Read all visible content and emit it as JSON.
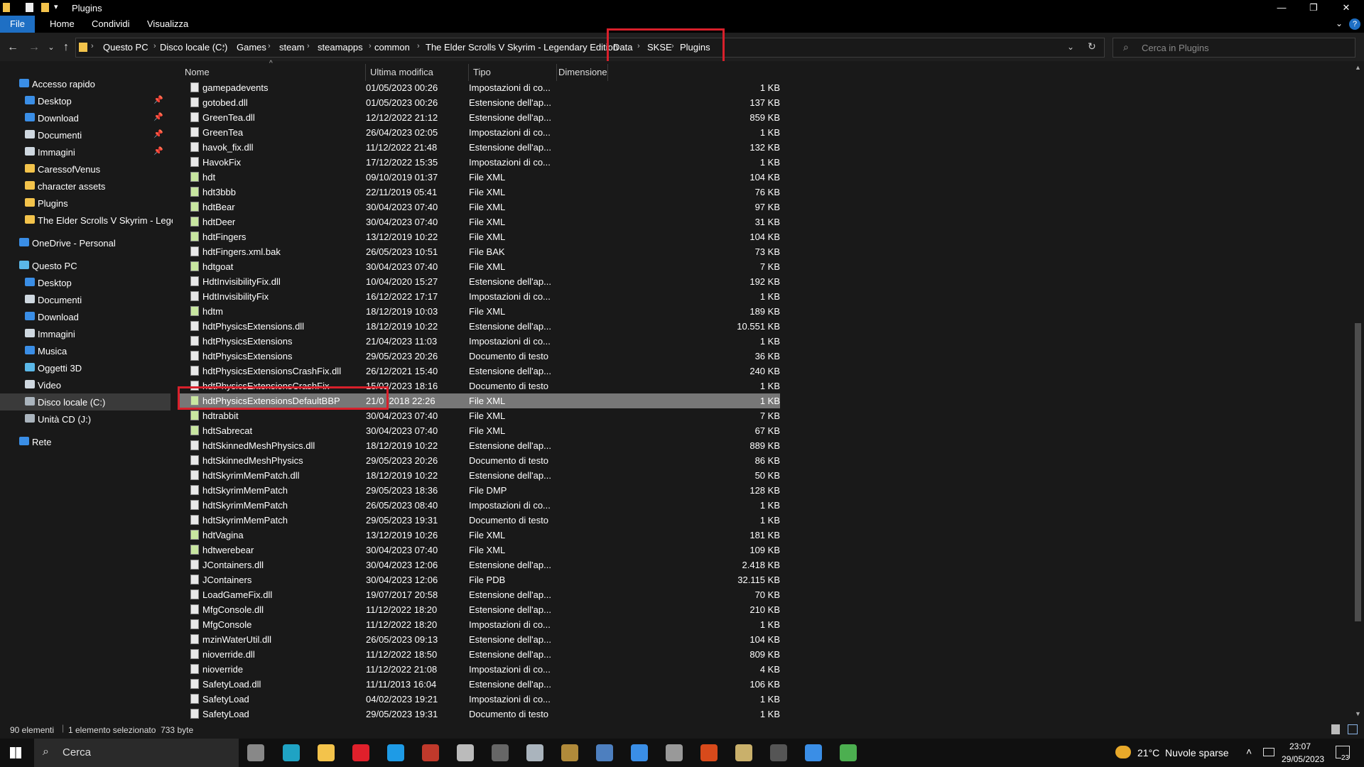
{
  "window": {
    "title": "Plugins",
    "min": "—",
    "max": "❐",
    "close": "✕"
  },
  "ribbon": {
    "tabs": [
      "File",
      "Home",
      "Condividi",
      "Visualizza"
    ]
  },
  "address": {
    "crumbs": [
      "Questo PC",
      "Disco locale (C:)",
      "Games",
      "steam",
      "steamapps",
      "common",
      "The Elder Scrolls V Skyrim - Legendary Edition",
      "Data",
      "SKSE",
      "Plugins"
    ],
    "search_placeholder": "Cerca in Plugins"
  },
  "nav": {
    "quick_access": "Accesso rapido",
    "quick_items": [
      {
        "label": "Desktop",
        "pinned": true,
        "icon": "desktop-icon",
        "color": "#3a8ee6"
      },
      {
        "label": "Download",
        "pinned": true,
        "icon": "download-icon",
        "color": "#3a8ee6"
      },
      {
        "label": "Documenti",
        "pinned": true,
        "icon": "documents-icon",
        "color": "#cfd8e0"
      },
      {
        "label": "Immagini",
        "pinned": true,
        "icon": "pictures-icon",
        "color": "#cfd8e0"
      },
      {
        "label": "CaressofVenus",
        "pinned": false,
        "icon": "folder-icon",
        "color": "#f3c34b"
      },
      {
        "label": "character assets",
        "pinned": false,
        "icon": "folder-icon",
        "color": "#f3c34b"
      },
      {
        "label": "Plugins",
        "pinned": false,
        "icon": "folder-icon",
        "color": "#f3c34b"
      },
      {
        "label": "The Elder Scrolls V Skyrim - Legendary",
        "pinned": false,
        "icon": "folder-icon",
        "color": "#f3c34b"
      }
    ],
    "onedrive": "OneDrive - Personal",
    "this_pc": "Questo PC",
    "pc_items": [
      {
        "label": "Desktop",
        "icon": "desktop-icon",
        "color": "#3a8ee6"
      },
      {
        "label": "Documenti",
        "icon": "documents-icon",
        "color": "#cfd8e0"
      },
      {
        "label": "Download",
        "icon": "download-icon",
        "color": "#3a8ee6"
      },
      {
        "label": "Immagini",
        "icon": "pictures-icon",
        "color": "#cfd8e0"
      },
      {
        "label": "Musica",
        "icon": "music-icon",
        "color": "#3a8ee6"
      },
      {
        "label": "Oggetti 3D",
        "icon": "3d-objects-icon",
        "color": "#5bb8e8"
      },
      {
        "label": "Video",
        "icon": "video-icon",
        "color": "#cfd8e0"
      },
      {
        "label": "Disco locale (C:)",
        "icon": "drive-icon",
        "color": "#aab4bd",
        "selected": true
      },
      {
        "label": "Unità CD (J:)",
        "icon": "cd-drive-icon",
        "color": "#aab4bd"
      }
    ],
    "network": "Rete"
  },
  "columns": {
    "name": "Nome",
    "modified": "Ultima modifica",
    "type": "Tipo",
    "size": "Dimensione"
  },
  "files": [
    {
      "name": "gamepadevents",
      "modified": "01/05/2023 00:26",
      "type": "Impostazioni di co...",
      "size": "1 KB",
      "kind": "ini"
    },
    {
      "name": "gotobed.dll",
      "modified": "01/05/2023 00:26",
      "type": "Estensione dell'ap...",
      "size": "137 KB",
      "kind": "dll"
    },
    {
      "name": "GreenTea.dll",
      "modified": "12/12/2022 21:12",
      "type": "Estensione dell'ap...",
      "size": "859 KB",
      "kind": "dll"
    },
    {
      "name": "GreenTea",
      "modified": "26/04/2023 02:05",
      "type": "Impostazioni di co...",
      "size": "1 KB",
      "kind": "ini"
    },
    {
      "name": "havok_fix.dll",
      "modified": "11/12/2022 21:48",
      "type": "Estensione dell'ap...",
      "size": "132 KB",
      "kind": "dll"
    },
    {
      "name": "HavokFix",
      "modified": "17/12/2022 15:35",
      "type": "Impostazioni di co...",
      "size": "1 KB",
      "kind": "ini"
    },
    {
      "name": "hdt",
      "modified": "09/10/2019 01:37",
      "type": "File XML",
      "size": "104 KB",
      "kind": "xml"
    },
    {
      "name": "hdt3bbb",
      "modified": "22/11/2019 05:41",
      "type": "File XML",
      "size": "76 KB",
      "kind": "xml"
    },
    {
      "name": "hdtBear",
      "modified": "30/04/2023 07:40",
      "type": "File XML",
      "size": "97 KB",
      "kind": "xml"
    },
    {
      "name": "hdtDeer",
      "modified": "30/04/2023 07:40",
      "type": "File XML",
      "size": "31 KB",
      "kind": "xml"
    },
    {
      "name": "hdtFingers",
      "modified": "13/12/2019 10:22",
      "type": "File XML",
      "size": "104 KB",
      "kind": "xml"
    },
    {
      "name": "hdtFingers.xml.bak",
      "modified": "26/05/2023 10:51",
      "type": "File BAK",
      "size": "73 KB",
      "kind": "bak"
    },
    {
      "name": "hdtgoat",
      "modified": "30/04/2023 07:40",
      "type": "File XML",
      "size": "7 KB",
      "kind": "xml"
    },
    {
      "name": "HdtInvisibilityFix.dll",
      "modified": "10/04/2020 15:27",
      "type": "Estensione dell'ap...",
      "size": "192 KB",
      "kind": "dll"
    },
    {
      "name": "HdtInvisibilityFix",
      "modified": "16/12/2022 17:17",
      "type": "Impostazioni di co...",
      "size": "1 KB",
      "kind": "ini"
    },
    {
      "name": "hdtm",
      "modified": "18/12/2019 10:03",
      "type": "File XML",
      "size": "189 KB",
      "kind": "xml"
    },
    {
      "name": "hdtPhysicsExtensions.dll",
      "modified": "18/12/2019 10:22",
      "type": "Estensione dell'ap...",
      "size": "10.551 KB",
      "kind": "dll"
    },
    {
      "name": "hdtPhysicsExtensions",
      "modified": "21/04/2023 11:03",
      "type": "Impostazioni di co...",
      "size": "1 KB",
      "kind": "ini"
    },
    {
      "name": "hdtPhysicsExtensions",
      "modified": "29/05/2023 20:26",
      "type": "Documento di testo",
      "size": "36 KB",
      "kind": "txt"
    },
    {
      "name": "hdtPhysicsExtensionsCrashFix.dll",
      "modified": "26/12/2021 15:40",
      "type": "Estensione dell'ap...",
      "size": "240 KB",
      "kind": "dll"
    },
    {
      "name": "hdtPhysicsExtensionsCrashFix",
      "modified": "15/02/2023 18:16",
      "type": "Documento di testo",
      "size": "1 KB",
      "kind": "txt"
    },
    {
      "name": "hdtPhysicsExtensionsDefaultBBP",
      "modified": "21/0 /2018 22:26",
      "type": "File XML",
      "size": "1 KB",
      "kind": "xml",
      "selected": true
    },
    {
      "name": "hdtrabbit",
      "modified": "30/04/2023 07:40",
      "type": "File XML",
      "size": "7 KB",
      "kind": "xml"
    },
    {
      "name": "hdtSabrecat",
      "modified": "30/04/2023 07:40",
      "type": "File XML",
      "size": "67 KB",
      "kind": "xml"
    },
    {
      "name": "hdtSkinnedMeshPhysics.dll",
      "modified": "18/12/2019 10:22",
      "type": "Estensione dell'ap...",
      "size": "889 KB",
      "kind": "dll"
    },
    {
      "name": "hdtSkinnedMeshPhysics",
      "modified": "29/05/2023 20:26",
      "type": "Documento di testo",
      "size": "86 KB",
      "kind": "txt"
    },
    {
      "name": "hdtSkyrimMemPatch.dll",
      "modified": "18/12/2019 10:22",
      "type": "Estensione dell'ap...",
      "size": "50 KB",
      "kind": "dll"
    },
    {
      "name": "hdtSkyrimMemPatch",
      "modified": "29/05/2023 18:36",
      "type": "File DMP",
      "size": "128 KB",
      "kind": "dmp"
    },
    {
      "name": "hdtSkyrimMemPatch",
      "modified": "26/05/2023 08:40",
      "type": "Impostazioni di co...",
      "size": "1 KB",
      "kind": "ini"
    },
    {
      "name": "hdtSkyrimMemPatch",
      "modified": "29/05/2023 19:31",
      "type": "Documento di testo",
      "size": "1 KB",
      "kind": "txt"
    },
    {
      "name": "hdtVagina",
      "modified": "13/12/2019 10:26",
      "type": "File XML",
      "size": "181 KB",
      "kind": "xml"
    },
    {
      "name": "hdtwerebear",
      "modified": "30/04/2023 07:40",
      "type": "File XML",
      "size": "109 KB",
      "kind": "xml"
    },
    {
      "name": "JContainers.dll",
      "modified": "30/04/2023 12:06",
      "type": "Estensione dell'ap...",
      "size": "2.418 KB",
      "kind": "dll"
    },
    {
      "name": "JContainers",
      "modified": "30/04/2023 12:06",
      "type": "File PDB",
      "size": "32.115 KB",
      "kind": "pdb"
    },
    {
      "name": "LoadGameFix.dll",
      "modified": "19/07/2017 20:58",
      "type": "Estensione dell'ap...",
      "size": "70 KB",
      "kind": "dll"
    },
    {
      "name": "MfgConsole.dll",
      "modified": "11/12/2022 18:20",
      "type": "Estensione dell'ap...",
      "size": "210 KB",
      "kind": "dll"
    },
    {
      "name": "MfgConsole",
      "modified": "11/12/2022 18:20",
      "type": "Impostazioni di co...",
      "size": "1 KB",
      "kind": "ini"
    },
    {
      "name": "mzinWaterUtil.dll",
      "modified": "26/05/2023 09:13",
      "type": "Estensione dell'ap...",
      "size": "104 KB",
      "kind": "dll"
    },
    {
      "name": "nioverride.dll",
      "modified": "11/12/2022 18:50",
      "type": "Estensione dell'ap...",
      "size": "809 KB",
      "kind": "dll"
    },
    {
      "name": "nioverride",
      "modified": "11/12/2022 21:08",
      "type": "Impostazioni di co...",
      "size": "4 KB",
      "kind": "ini"
    },
    {
      "name": "SafetyLoad.dll",
      "modified": "11/11/2013 16:04",
      "type": "Estensione dell'ap...",
      "size": "106 KB",
      "kind": "dll"
    },
    {
      "name": "SafetyLoad",
      "modified": "04/02/2023 19:21",
      "type": "Impostazioni di co...",
      "size": "1 KB",
      "kind": "ini"
    },
    {
      "name": "SafetyLoad",
      "modified": "29/05/2023 19:31",
      "type": "Documento di testo",
      "size": "1 KB",
      "kind": "txt"
    }
  ],
  "status": {
    "count": "90 elementi",
    "selection": "1 elemento selezionato  733 byte"
  },
  "taskbar": {
    "search": "Cerca",
    "weather": "21°C  Nuvole sparse",
    "time": "23:07",
    "date": "29/05/2023",
    "notifications": "23"
  },
  "colors": {
    "accent": "#1e6fc4",
    "highlight": "#d8202b",
    "selection": "#777777"
  }
}
